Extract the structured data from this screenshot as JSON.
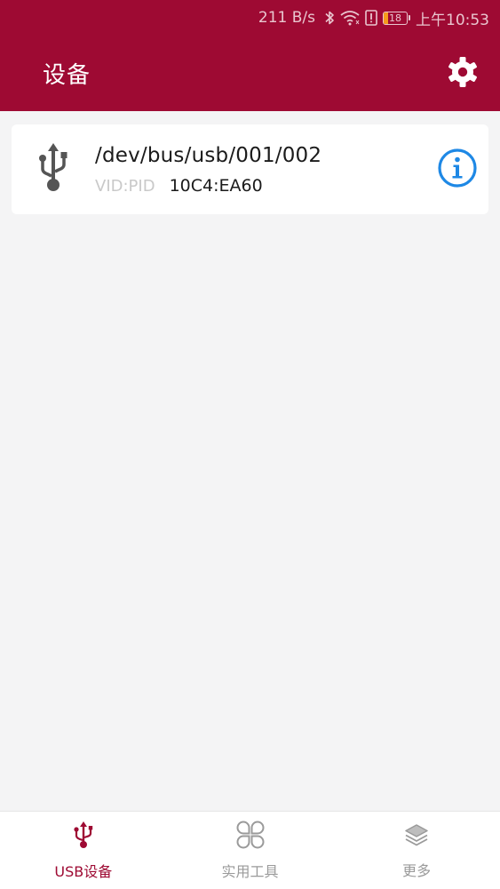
{
  "status_bar": {
    "net_speed": "211 B/s",
    "battery_level": "18",
    "time": "上午10:53",
    "icons": [
      "bluetooth-icon",
      "wifi-icon",
      "alert-icon",
      "battery-icon"
    ]
  },
  "app_bar": {
    "title": "设备",
    "settings_icon": "gear-icon"
  },
  "devices": [
    {
      "path": "/dev/bus/usb/001/002",
      "vidpid_label": "VID:PID",
      "vidpid_value": "10C4:EA60",
      "icon": "usb-icon",
      "action_icon": "info-icon"
    }
  ],
  "bottom_nav": {
    "items": [
      {
        "label": "USB设备",
        "icon": "usb-icon",
        "active": true
      },
      {
        "label": "实用工具",
        "icon": "tools-grid-icon",
        "active": false
      },
      {
        "label": "更多",
        "icon": "layers-icon",
        "active": false
      }
    ]
  },
  "colors": {
    "primary": "#9e0a33",
    "info_blue": "#1e88e5",
    "inactive": "#9a9a9a",
    "background": "#f4f4f5"
  }
}
